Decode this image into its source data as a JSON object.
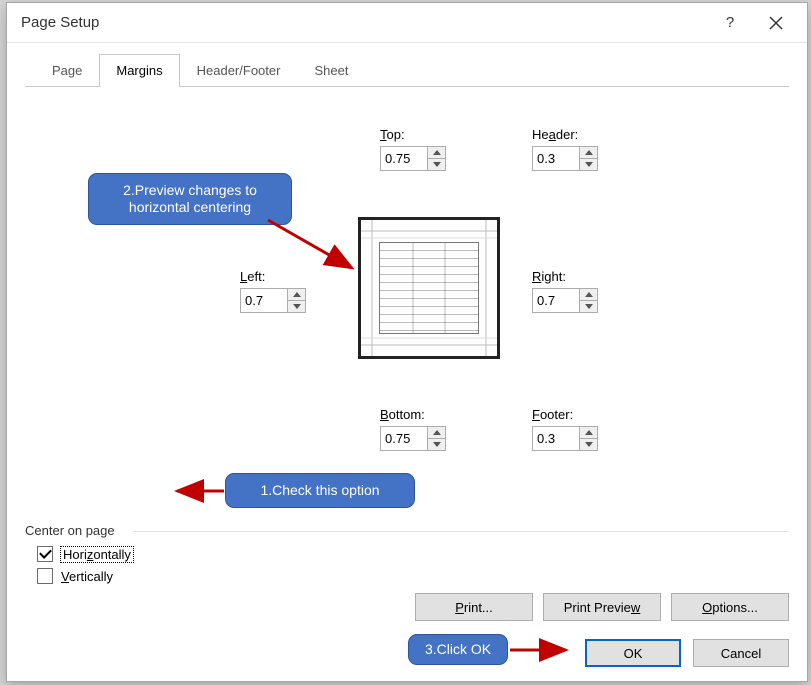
{
  "dialog": {
    "title": "Page Setup"
  },
  "titlebar": {
    "help_tooltip": "Help",
    "close_tooltip": "Close"
  },
  "tabs": {
    "page": "Page",
    "margins": "Margins",
    "header_footer": "Header/Footer",
    "sheet": "Sheet",
    "active": "margins"
  },
  "margins": {
    "top_label": "Top:",
    "top_value": "0.75",
    "header_label": "Header:",
    "header_value": "0.3",
    "left_label": "Left:",
    "left_value": "0.7",
    "right_label": "Right:",
    "right_value": "0.7",
    "bottom_label": "Bottom:",
    "bottom_value": "0.75",
    "footer_label": "Footer:",
    "footer_value": "0.3"
  },
  "center_on_page": {
    "legend": "Center on page",
    "horizontally_label": "Horizontally",
    "horizontally_checked": true,
    "vertically_label": "Vertically",
    "vertically_checked": false
  },
  "buttons": {
    "print": "Print...",
    "print_preview": "Print Preview",
    "options": "Options...",
    "ok": "OK",
    "cancel": "Cancel"
  },
  "annotations": {
    "step1": "1.Check this option",
    "step2": "2.Preview changes to horizontal centering",
    "step3": "3.Click OK"
  }
}
